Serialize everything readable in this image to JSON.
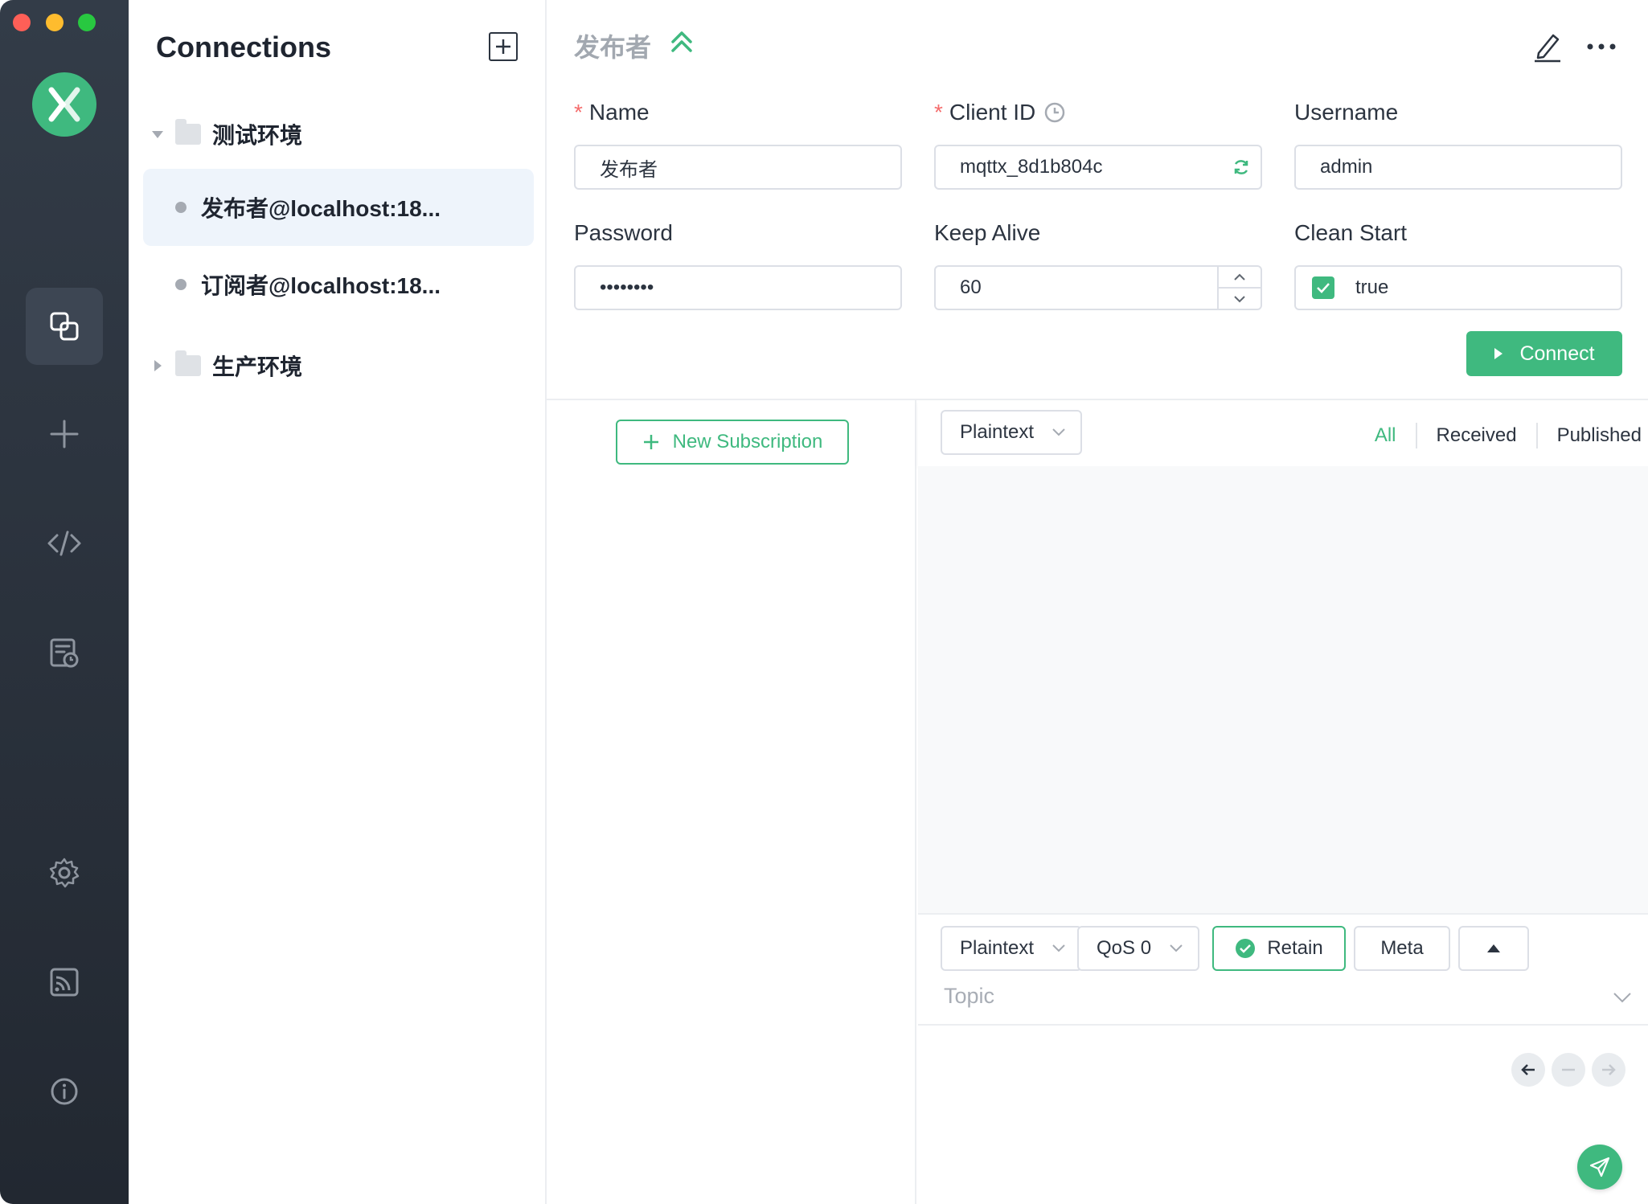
{
  "sidebar": {
    "icons": [
      "connections-icon",
      "plus-icon",
      "script-icon",
      "log-icon",
      "settings-icon",
      "feed-icon",
      "info-icon"
    ]
  },
  "connections": {
    "title": "Connections",
    "groups": [
      {
        "name": "测试环境",
        "expanded": true
      },
      {
        "name": "生产环境",
        "expanded": false
      }
    ],
    "items": [
      {
        "label": "发布者@localhost:18...",
        "active": true
      },
      {
        "label": "订阅者@localhost:18...",
        "active": false
      }
    ]
  },
  "header": {
    "title": "发布者"
  },
  "form": {
    "name_label": "Name",
    "name_value": "发布者",
    "client_id_label": "Client ID",
    "client_id_value": "mqttx_8d1b804c",
    "username_label": "Username",
    "username_value": "admin",
    "password_label": "Password",
    "password_value": "••••••••",
    "keep_alive_label": "Keep Alive",
    "keep_alive_value": "60",
    "clean_start_label": "Clean Start",
    "clean_start_value": "true",
    "connect_label": "Connect"
  },
  "subscriptions": {
    "new_label": "New Subscription"
  },
  "messages": {
    "format": "Plaintext",
    "tabs": [
      "All",
      "Received",
      "Published"
    ],
    "active_tab": "All"
  },
  "compose": {
    "format": "Plaintext",
    "qos": "QoS 0",
    "retain_label": "Retain",
    "meta_label": "Meta",
    "topic_placeholder": "Topic"
  },
  "colors": {
    "accent": "#3fb97f",
    "rail": "#2a313b",
    "required": "#f56c6c"
  }
}
